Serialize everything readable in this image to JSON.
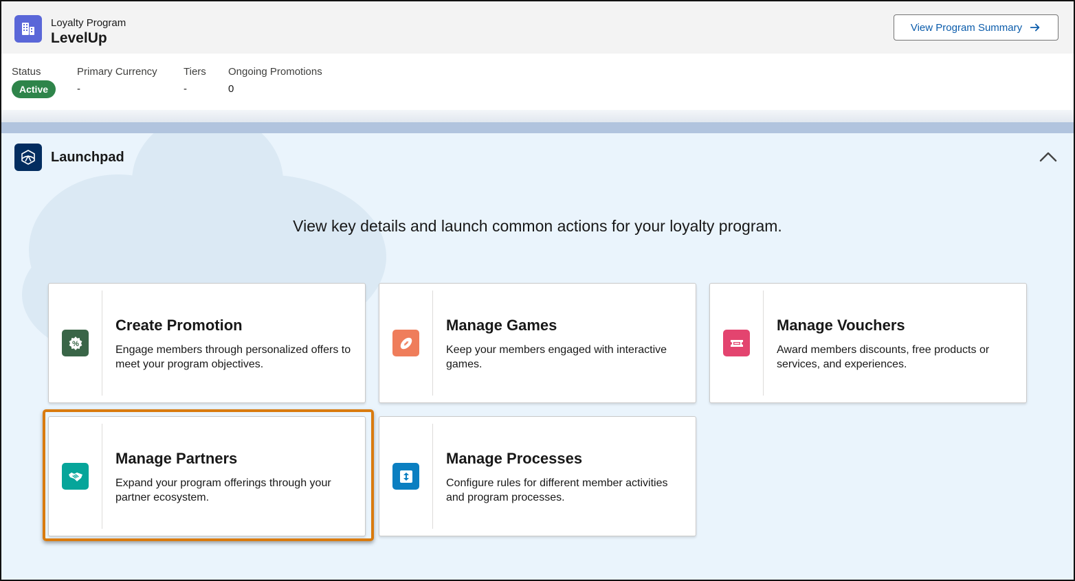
{
  "header": {
    "subtitle": "Loyalty Program",
    "title": "LevelUp",
    "summary_button": "View Program Summary"
  },
  "highlights": {
    "status_label": "Status",
    "status_value": "Active",
    "currency_label": "Primary Currency",
    "currency_value": "-",
    "tiers_label": "Tiers",
    "tiers_value": "-",
    "promotions_label": "Ongoing Promotions",
    "promotions_value": "0"
  },
  "launchpad": {
    "title": "Launchpad",
    "description": "View key details and launch common actions for your loyalty program.",
    "cards": [
      {
        "title": "Create Promotion",
        "description": "Engage members through personalized offers to meet your program objectives.",
        "icon": "promotion-icon",
        "color": "#396547"
      },
      {
        "title": "Manage Games",
        "description": "Keep your members engaged with interactive games.",
        "icon": "football-icon",
        "color": "#ef7d5b"
      },
      {
        "title": "Manage Vouchers",
        "description": "Award members discounts, free products or services, and experiences.",
        "icon": "voucher-icon",
        "color": "#e3446f"
      },
      {
        "title": "Manage Partners",
        "description": "Expand your program offerings through your partner ecosystem.",
        "icon": "handshake-icon",
        "color": "#06a59a"
      },
      {
        "title": "Manage Processes",
        "description": "Configure rules for different member activities and program processes.",
        "icon": "process-icon",
        "color": "#0b7fc1"
      }
    ]
  },
  "colors": {
    "brand_link": "#0b5cab",
    "active_badge": "#2e844a",
    "highlight_border": "#d97b0f",
    "app_icon": "#5a67d8",
    "launchpad_icon": "#032d60"
  }
}
